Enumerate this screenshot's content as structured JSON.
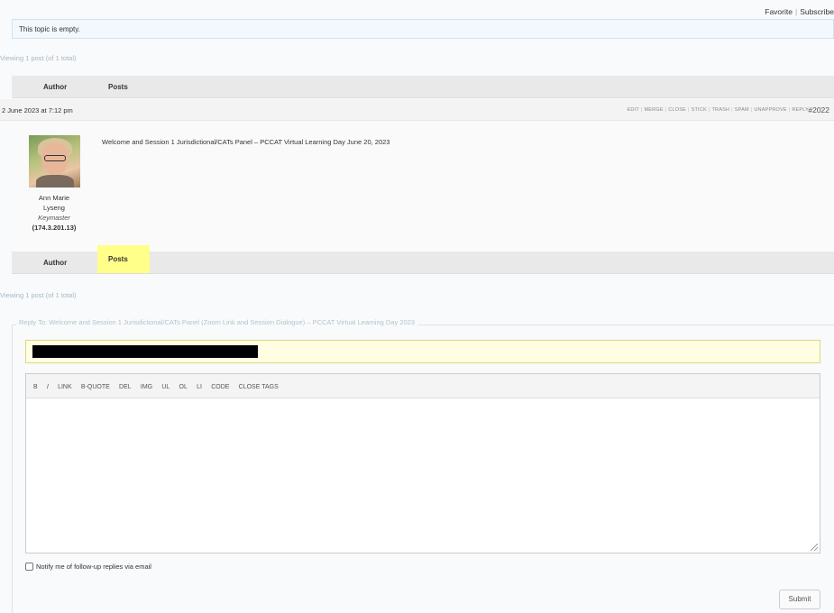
{
  "topbar": {
    "favorite": "Favorite",
    "separator": "|",
    "subscribe": "Subscribe"
  },
  "notice": "This topic is empty.",
  "pagination": {
    "top": "Viewing 1 post (of 1 total)",
    "bottom": "Viewing 1 post (of 1 total)"
  },
  "table_header": {
    "author": "Author",
    "posts": "Posts"
  },
  "table_footer": {
    "author": "Author",
    "posts": "Posts"
  },
  "post": {
    "date": "2 June 2023 at 7:12 pm",
    "admin_links": [
      "EDIT",
      "MERGE",
      "CLOSE",
      "STICK",
      "TRASH",
      "SPAM",
      "UNAPPROVE",
      "REPLY"
    ],
    "number": "#2022",
    "title": "Welcome and Session 1 Jurisdictional/CATs Panel – PCCAT Virtual Learning Day June 20, 2023",
    "author": {
      "name_line1": "Ann Marie",
      "name_line2": "Lyseng",
      "role": "Keymaster",
      "ip": "(174.3.201.13)",
      "avatar_icon": "user-avatar-photo"
    }
  },
  "reply_form": {
    "legend": "Reply To: Welcome and Session 1 Jurisdictional/CATs Panel (Zoom Link and Session Dialogue) – PCCAT Virtual Learning Day 2023",
    "toolbar": [
      "B",
      "I",
      "LINK",
      "B-QUOTE",
      "DEL",
      "IMG",
      "UL",
      "OL",
      "LI",
      "CODE",
      "CLOSE TAGS"
    ],
    "notify_label": "Notify me of follow-up replies via email",
    "submit_label": "Submit"
  },
  "colors": {
    "highlight": "#ffff8a",
    "notice_bg": "#f2f8fd",
    "title_input_bg": "#fffde2"
  }
}
